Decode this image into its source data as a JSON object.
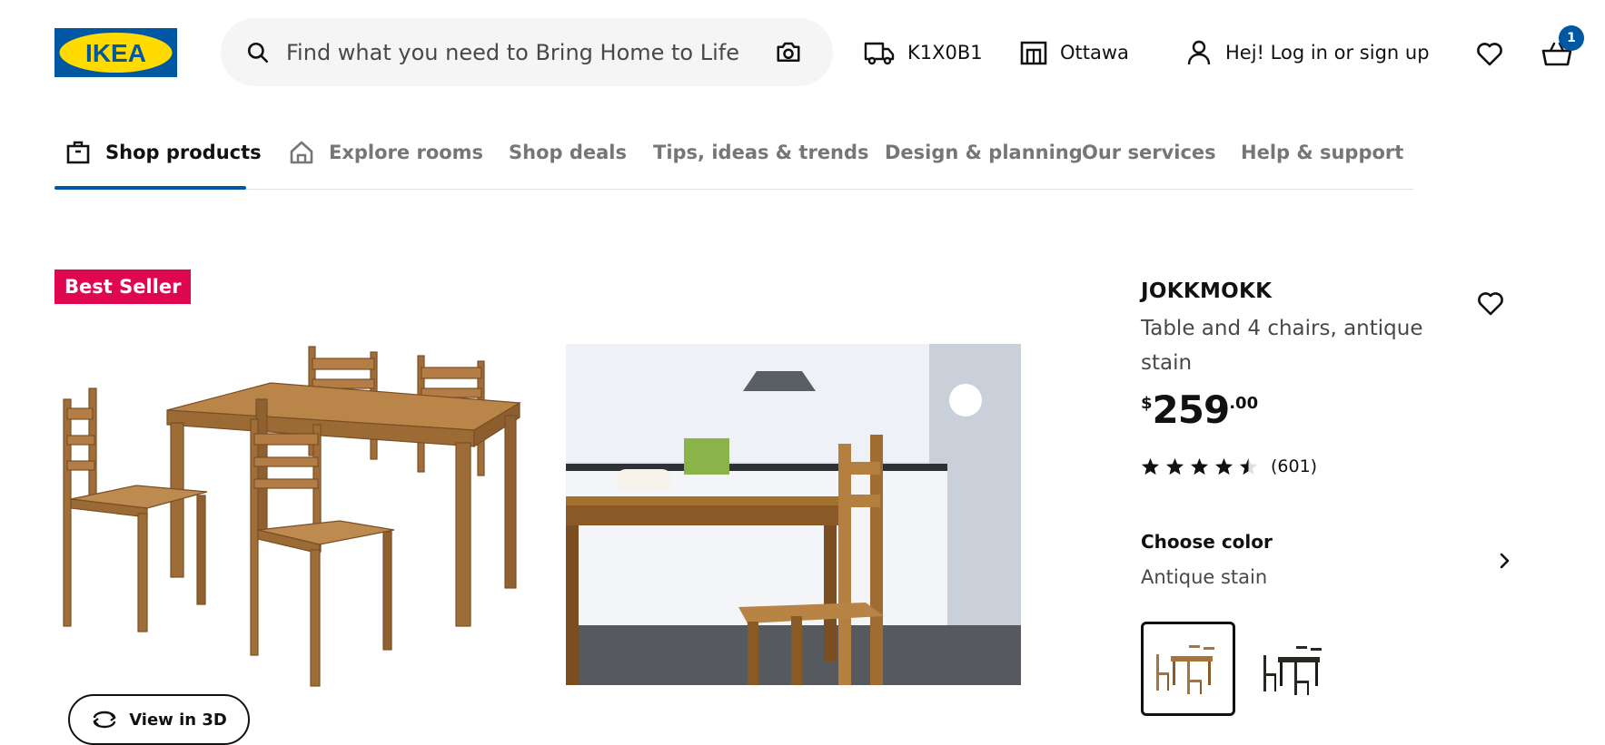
{
  "header": {
    "logo_text": "IKEA",
    "search_placeholder": "Find what you need to Bring Home to Life",
    "postal_code": "K1X0B1",
    "store": "Ottawa",
    "login": "Hej! Log in or sign up",
    "cart_count": "1",
    "icons": [
      "search-icon",
      "camera-icon",
      "truck-icon",
      "store-icon",
      "user-icon",
      "heart-icon",
      "cart-icon"
    ]
  },
  "nav": {
    "tabs": [
      {
        "label": "Shop products",
        "active": true
      },
      {
        "label": "Explore rooms"
      },
      {
        "label": "Shop deals"
      },
      {
        "label": "Tips, ideas & trends"
      },
      {
        "label": "Design & planning"
      },
      {
        "label": "Our services"
      },
      {
        "label": "Help & support"
      }
    ]
  },
  "product": {
    "badge": "Best Seller",
    "name": "JOKKMOKK",
    "description": "Table and 4 chairs, antique stain",
    "price": {
      "currency": "$",
      "integer": "259",
      "decimal": ".00"
    },
    "rating": {
      "stars": 4.5,
      "count": "(601)"
    },
    "view_3d": "View in 3D",
    "color": {
      "title": "Choose color",
      "value": "Antique stain",
      "swatches": [
        "antique-stain",
        "black-brown"
      ]
    }
  },
  "colors": {
    "ikea_blue": "#0058a3",
    "ikea_yellow": "#ffdb00",
    "best_seller": "#e00751",
    "wood": "#a8743d"
  }
}
